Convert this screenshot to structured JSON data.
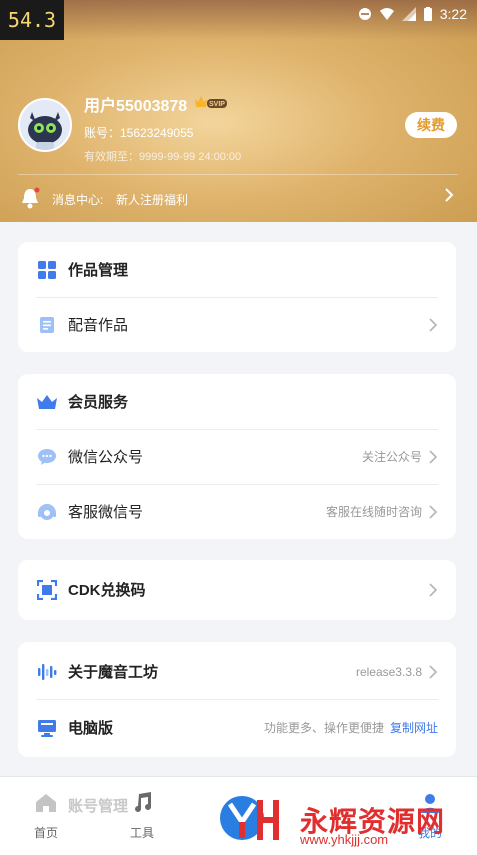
{
  "overlay": {
    "fps": "54.3"
  },
  "status_bar": {
    "time": "3:22"
  },
  "profile": {
    "username": "用户55003878",
    "vip_badge": "SVIP",
    "account": "账号：15623249055",
    "expire": "有效期至：9999-99-99 24:00:00",
    "renew_label": "续费"
  },
  "notice": {
    "label": "消息中心:",
    "text": "新人注册福利"
  },
  "sections": {
    "works": {
      "title": "作品管理",
      "item": "配音作品"
    },
    "member": {
      "title": "会员服务",
      "wechat_official": {
        "label": "微信公众号",
        "hint": "关注公众号"
      },
      "wechat_service": {
        "label": "客服微信号",
        "hint": "客服在线随时咨询"
      }
    },
    "cdk": {
      "title": "CDK兑换码"
    },
    "about": {
      "title": "关于魔音工坊",
      "version": "release3.3.8",
      "pc": {
        "title": "电脑版",
        "hint": "功能更多、操作更便捷",
        "link": "复制网址"
      }
    }
  },
  "tabbar": {
    "home": "首页",
    "tools": "工具",
    "ghost_text": "账号管理",
    "mine": "我的"
  },
  "watermark": {
    "title": "永辉资源网",
    "url": "www.yhkjjj.com"
  },
  "colors": {
    "accent": "#3f7be9",
    "gold": "#d9ab62",
    "renew": "#e39a2e",
    "watermark": "#e12e2e"
  }
}
